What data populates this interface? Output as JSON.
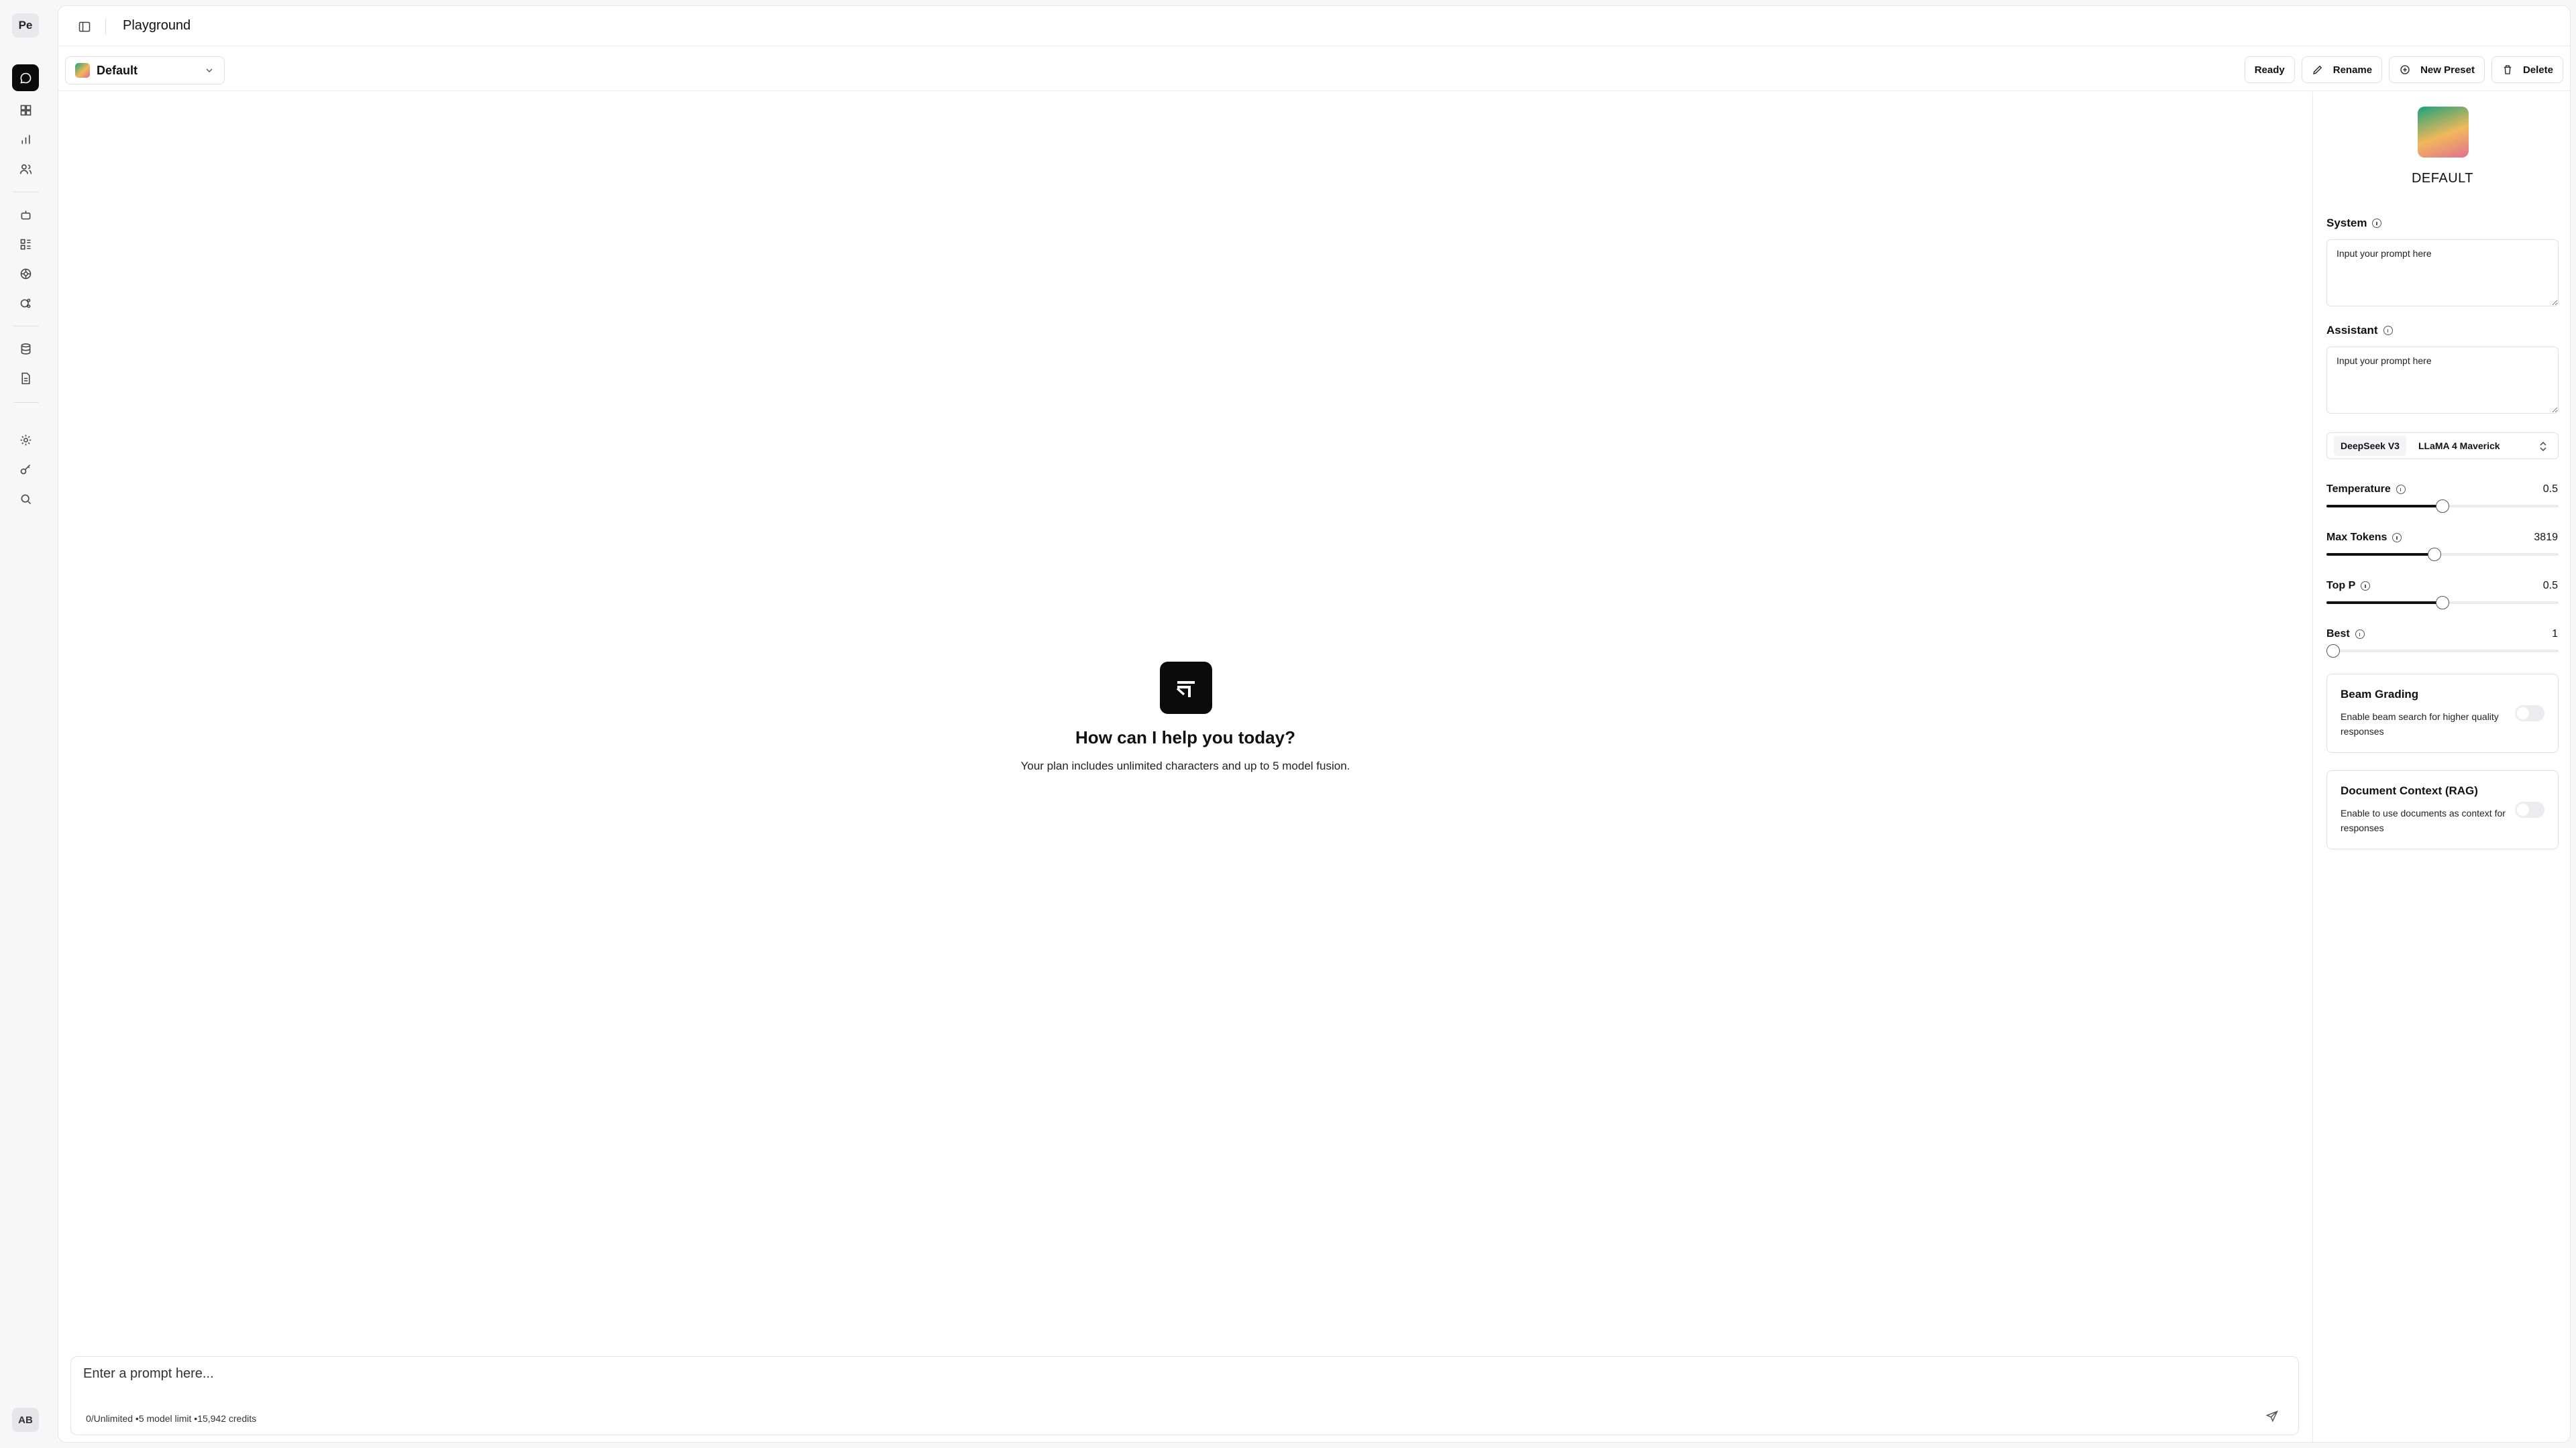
{
  "rail": {
    "logo": "Pe",
    "avatar": "AB"
  },
  "header": {
    "title": "Playground"
  },
  "toolbar": {
    "preset": "Default",
    "status": "Ready",
    "rename": "Rename",
    "new_preset": "New Preset",
    "delete": "Delete"
  },
  "hero": {
    "title": "How can I help you today?",
    "subtitle": "Your plan includes unlimited characters and up to 5 model fusion."
  },
  "composer": {
    "placeholder": "Enter a prompt here...",
    "meta": "0/Unlimited •5 model limit •15,942 credits"
  },
  "side": {
    "preset_name": "DEFAULT",
    "system_label": "System",
    "system_placeholder": "Input your prompt here",
    "assistant_label": "Assistant",
    "assistant_placeholder": "Input your prompt here",
    "models": [
      "DeepSeek V3",
      "LLaMA 4 Maverick"
    ],
    "temperature": {
      "label": "Temperature",
      "value": "0.5",
      "fraction": 0.5
    },
    "max_tokens": {
      "label": "Max Tokens",
      "value": "3819",
      "fraction": 0.466
    },
    "top_p": {
      "label": "Top P",
      "value": "0.5",
      "fraction": 0.5
    },
    "best": {
      "label": "Best",
      "value": "1",
      "fraction": 0.0
    },
    "beam": {
      "title": "Beam Grading",
      "desc": "Enable beam search for higher quality responses"
    },
    "rag": {
      "title": "Document Context (RAG)",
      "desc": "Enable to use documents as context for responses"
    }
  },
  "colors": {
    "accent": "#0b0b0b",
    "border": "#e0e0e4"
  }
}
